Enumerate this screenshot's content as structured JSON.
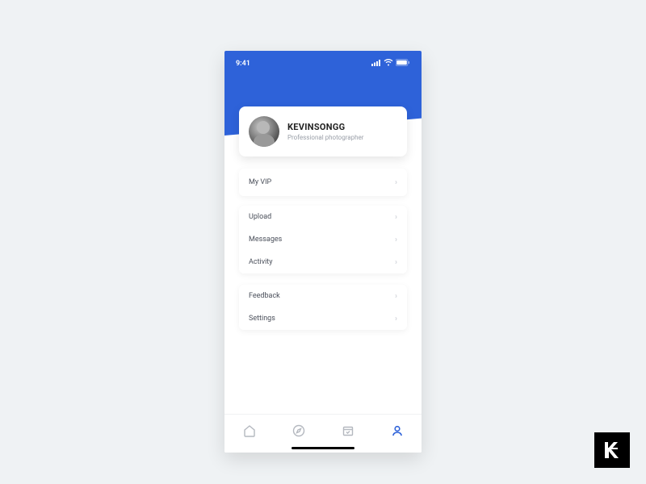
{
  "status": {
    "time": "9:41"
  },
  "profile": {
    "name": "KEVINSONGG",
    "subtitle": "Professional  photographer"
  },
  "groups": {
    "vip": {
      "label": "My VIP"
    },
    "mid": [
      {
        "label": "Upload"
      },
      {
        "label": "Messages"
      },
      {
        "label": "Activity"
      }
    ],
    "bot": [
      {
        "label": "Feedback"
      },
      {
        "label": "Settings"
      }
    ]
  }
}
